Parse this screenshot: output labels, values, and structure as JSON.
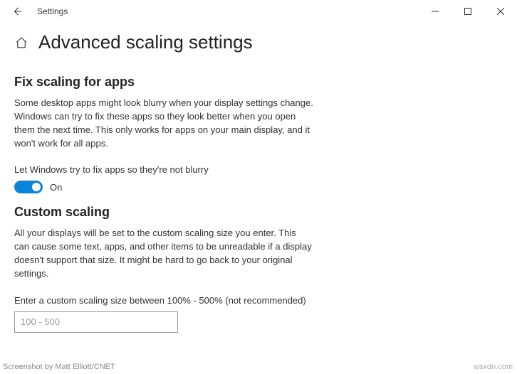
{
  "window": {
    "app_title": "Settings"
  },
  "header": {
    "page_title": "Advanced scaling settings"
  },
  "section1": {
    "heading": "Fix scaling for apps",
    "description": "Some desktop apps might look blurry when your display settings change. Windows can try to fix these apps so they look better when you open them the next time. This only works for apps on your main display, and it won't work for all apps.",
    "toggle_label": "Let Windows try to fix apps so they're not blurry",
    "toggle_state": "On"
  },
  "section2": {
    "heading": "Custom scaling",
    "description": "All your displays will be set to the custom scaling size you enter. This can cause some text, apps, and other items to be unreadable if a display doesn't support that size. It might be hard to go back to your original settings.",
    "input_label": "Enter a custom scaling size between 100% - 500% (not recommended)",
    "input_placeholder": "100 - 500"
  },
  "footer": {
    "credit": "Screenshot by Matt Elliott/CNET",
    "watermark": "wsxdn.com"
  }
}
